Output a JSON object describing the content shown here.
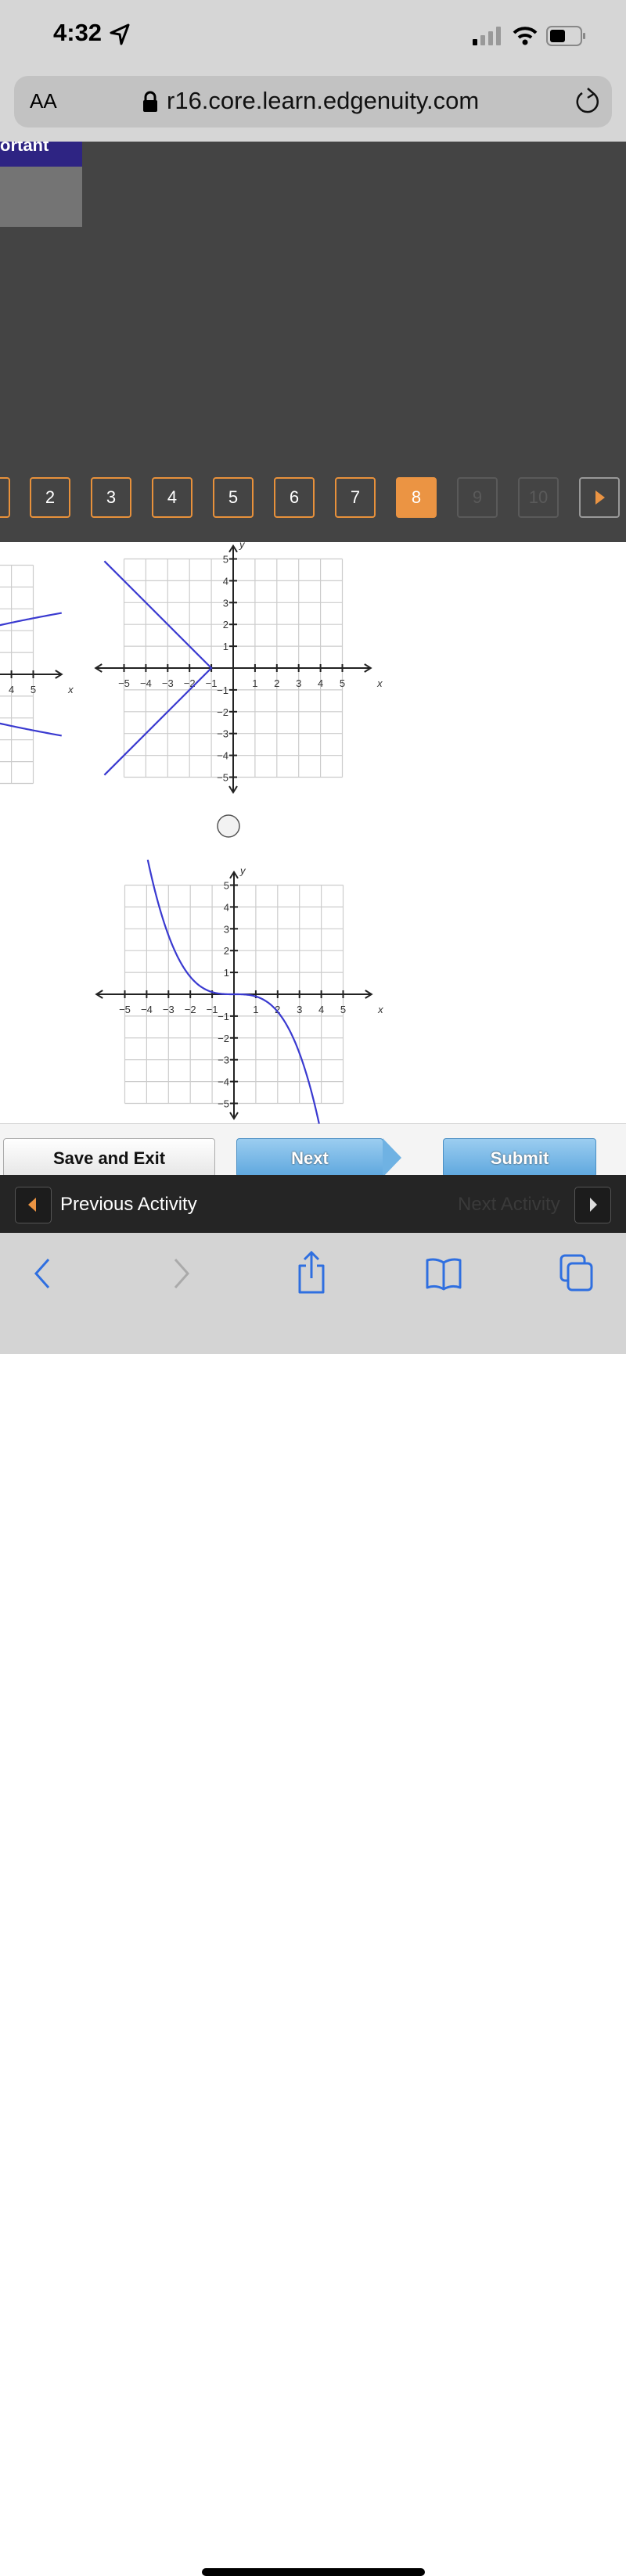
{
  "status_bar": {
    "time": "4:32",
    "icons": [
      "location-arrow-icon",
      "signal-icon",
      "wifi-icon",
      "battery-icon"
    ]
  },
  "browser": {
    "text_size_label": "AA",
    "url": "r16.core.learn.edgenuity.com",
    "icons": [
      "lock-icon",
      "reload-icon"
    ]
  },
  "header": {
    "tab_label_partial": "ortant"
  },
  "pagination": {
    "pages": [
      "2",
      "3",
      "4",
      "5",
      "6",
      "7",
      "8",
      "9",
      "10"
    ],
    "current": "8",
    "disabled": [
      "9",
      "10"
    ],
    "accent": "#eb9443"
  },
  "graphs": {
    "x_label": "x",
    "y_label": "y",
    "ticks": [
      "-5",
      "-4",
      "-3",
      "-2",
      "-1",
      "1",
      "2",
      "3",
      "4",
      "5"
    ],
    "partial_ticks": [
      "4",
      "5"
    ],
    "curve_color": "#3a3ad0",
    "option_a": {
      "type": "line",
      "relation": "x = -|y| - 1",
      "xlim": [
        -5,
        5
      ],
      "ylim": [
        -5,
        5
      ]
    },
    "option_b": {
      "type": "line",
      "relation": "y = -x^3/10",
      "xlim": [
        -5,
        5
      ],
      "ylim": [
        -5,
        5
      ]
    }
  },
  "buttons": {
    "save": "Save and Exit",
    "next": "Next",
    "submit": "Submit"
  },
  "activity_bar": {
    "previous": "Previous Activity",
    "next": "Next Activity"
  }
}
